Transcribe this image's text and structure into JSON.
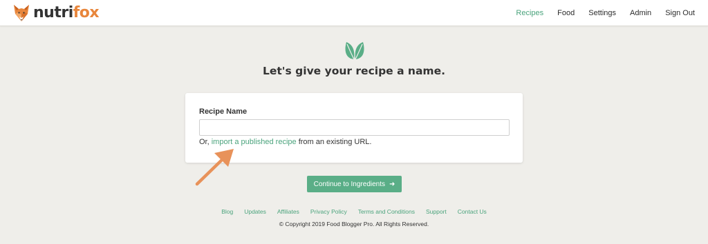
{
  "brand": {
    "part1": "nutri",
    "part2": "fox"
  },
  "nav": [
    {
      "label": "Recipes",
      "active": true
    },
    {
      "label": "Food",
      "active": false
    },
    {
      "label": "Settings",
      "active": false
    },
    {
      "label": "Admin",
      "active": false
    },
    {
      "label": "Sign Out",
      "active": false
    }
  ],
  "main": {
    "icon": "leaf-icon",
    "headline": "Let's give your recipe a name.",
    "card": {
      "label": "Recipe Name",
      "input_value": "",
      "import_prefix": "Or,",
      "import_link": "import a published recipe",
      "import_suffix": "from an existing URL."
    },
    "continue_label": "Continue to Ingredients"
  },
  "footer": {
    "links": [
      "Blog",
      "Updates",
      "Affiliates",
      "Privacy Policy",
      "Terms and Conditions",
      "Support",
      "Contact Us"
    ],
    "copyright": "© Copyright 2019 Food Blogger Pro. All Rights Reserved."
  },
  "colors": {
    "accent": "#5aae87",
    "link": "#4aa37c",
    "brand_orange": "#e8863c",
    "background": "#efeeea",
    "annotation_arrow": "#e8925a"
  }
}
